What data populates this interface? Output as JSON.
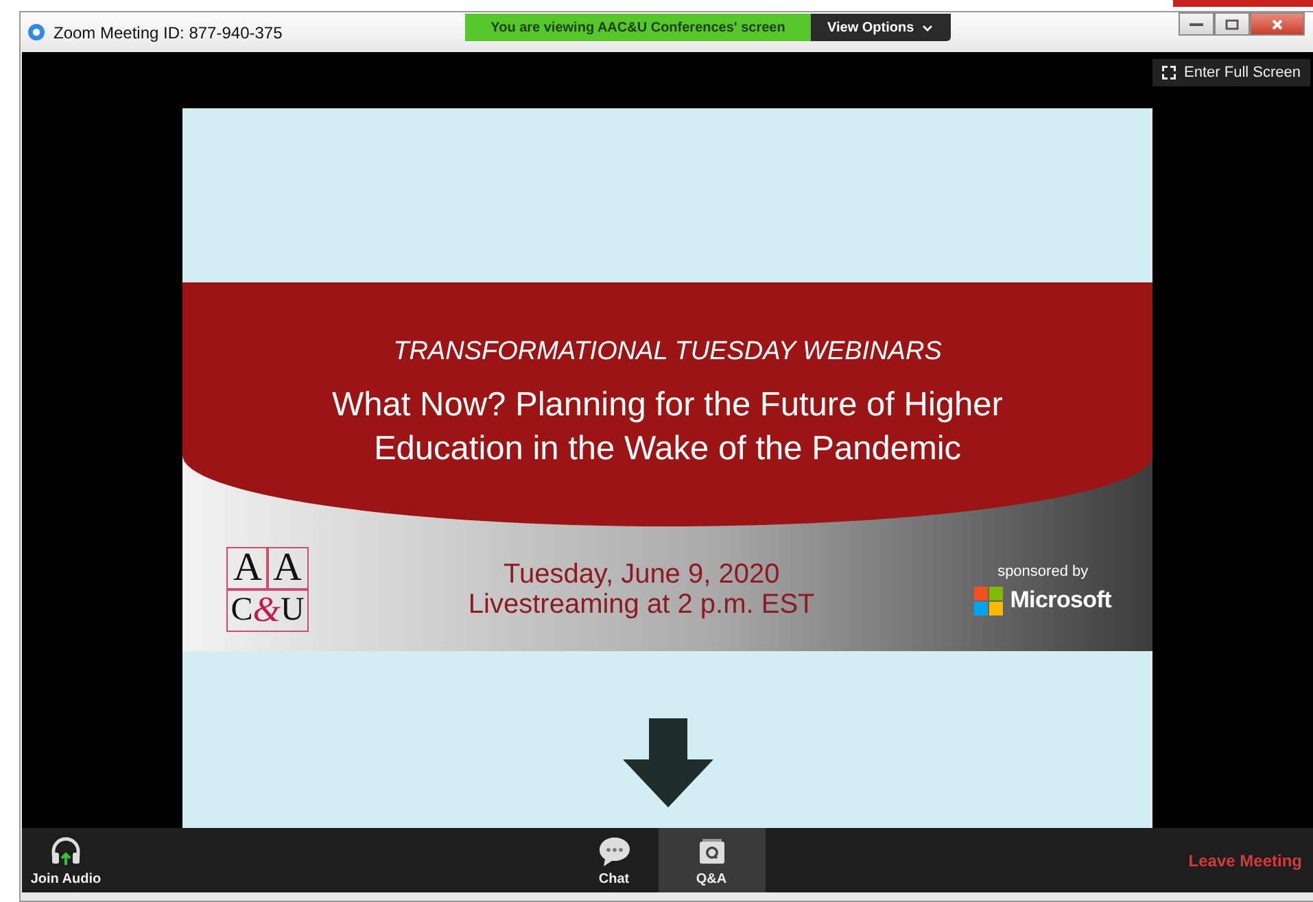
{
  "window": {
    "title": "Zoom Meeting ID: 877-940-375"
  },
  "share_banner": {
    "text": "You are viewing AAC&U Conferences' screen",
    "view_options": "View Options"
  },
  "full_screen_button": "Enter Full Screen",
  "slide": {
    "series": "TRANSFORMATIONAL TUESDAY WEBINARS",
    "title": "What Now? Planning for the Future of Higher Education in the Wake of the Pandemic",
    "logo_letters": [
      "A",
      "A",
      "C",
      "U"
    ],
    "logo_amp": "&",
    "date": "Tuesday, June 9, 2020",
    "time": "Livestreaming at 2 p.m. EST",
    "sponsor_label": "sponsored by",
    "sponsor": "Microsoft"
  },
  "toolbar": {
    "items": [
      {
        "label": "Join Audio",
        "kind": "audio",
        "selected": false
      },
      {
        "label": "Chat",
        "kind": "chat",
        "selected": false
      },
      {
        "label": "Q&A",
        "kind": "qa",
        "selected": true
      }
    ],
    "leave": "Leave Meeting"
  }
}
